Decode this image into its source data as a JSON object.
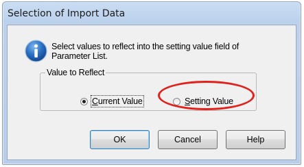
{
  "dialog": {
    "title": "Selection of Import Data",
    "message_line1": "Select values to reflect into the setting value field of",
    "message_line2": "Parameter List."
  },
  "group": {
    "legend": "Value to Reflect",
    "options": [
      {
        "label_first": "C",
        "label_rest": "urrent Value",
        "selected": true
      },
      {
        "label_first": "S",
        "label_rest": "etting Value",
        "selected": false
      }
    ]
  },
  "buttons": {
    "ok": "OK",
    "cancel": "Cancel",
    "help": "Help"
  },
  "icons": {
    "info": "information-icon"
  },
  "colors": {
    "highlight": "#e0211c",
    "info_blue": "#1e63b5"
  }
}
